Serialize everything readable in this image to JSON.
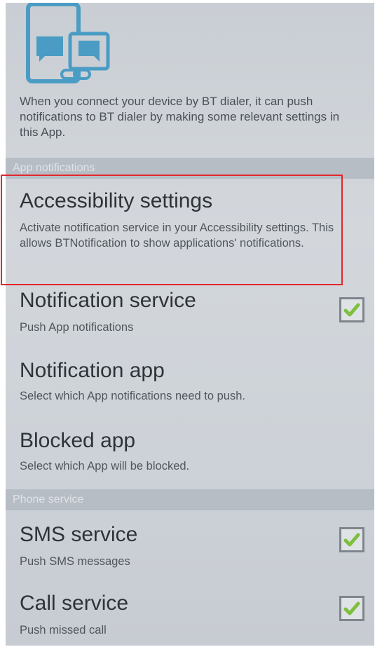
{
  "intro_text": "When you connect your device by BT dialer, it can push notifications to BT dialer by making some relevant settings in this App.",
  "sections": {
    "app_notifications": "App notifications",
    "phone_service": "Phone service"
  },
  "prefs": {
    "accessibility": {
      "title": "Accessibility settings",
      "summary": "Activate notification service in your Accessibility settings. This allows BTNotification to show applications' notifications."
    },
    "notification_service": {
      "title": "Notification service",
      "summary": "Push App notifications",
      "checked": true
    },
    "notification_app": {
      "title": "Notification app",
      "summary": "Select which App notifications need to push."
    },
    "blocked_app": {
      "title": "Blocked app",
      "summary": "Select which App will be blocked."
    },
    "sms_service": {
      "title": "SMS service",
      "summary": "Push SMS messages",
      "checked": true
    },
    "call_service": {
      "title": "Call service",
      "summary": "Push missed call",
      "checked": true
    }
  },
  "colors": {
    "highlight": "#e3262b",
    "check": "#7fbf3f",
    "accent_illustration": "#4a9cc4"
  }
}
